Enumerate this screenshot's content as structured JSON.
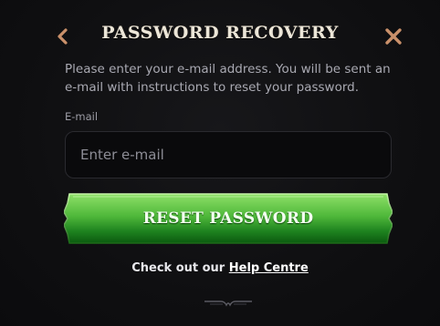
{
  "header": {
    "title": "PASSWORD RECOVERY",
    "back_icon": "chevron-left-icon",
    "close_icon": "close-icon"
  },
  "instructions": "Please enter your e-mail address. You will be sent an e-mail with instructions to reset your password.",
  "form": {
    "email_label": "E-mail",
    "email_placeholder": "Enter e-mail",
    "email_value": "",
    "submit_label": "RESET PASSWORD"
  },
  "help": {
    "prefix": "Check out our",
    "link_label": "Help Centre"
  },
  "colors": {
    "background": "#0f0f11",
    "accent_icon": "#c9906a",
    "button_green_top": "#7fd85a",
    "button_green_bottom": "#0b5a0f",
    "input_border": "#2a2a2f"
  }
}
